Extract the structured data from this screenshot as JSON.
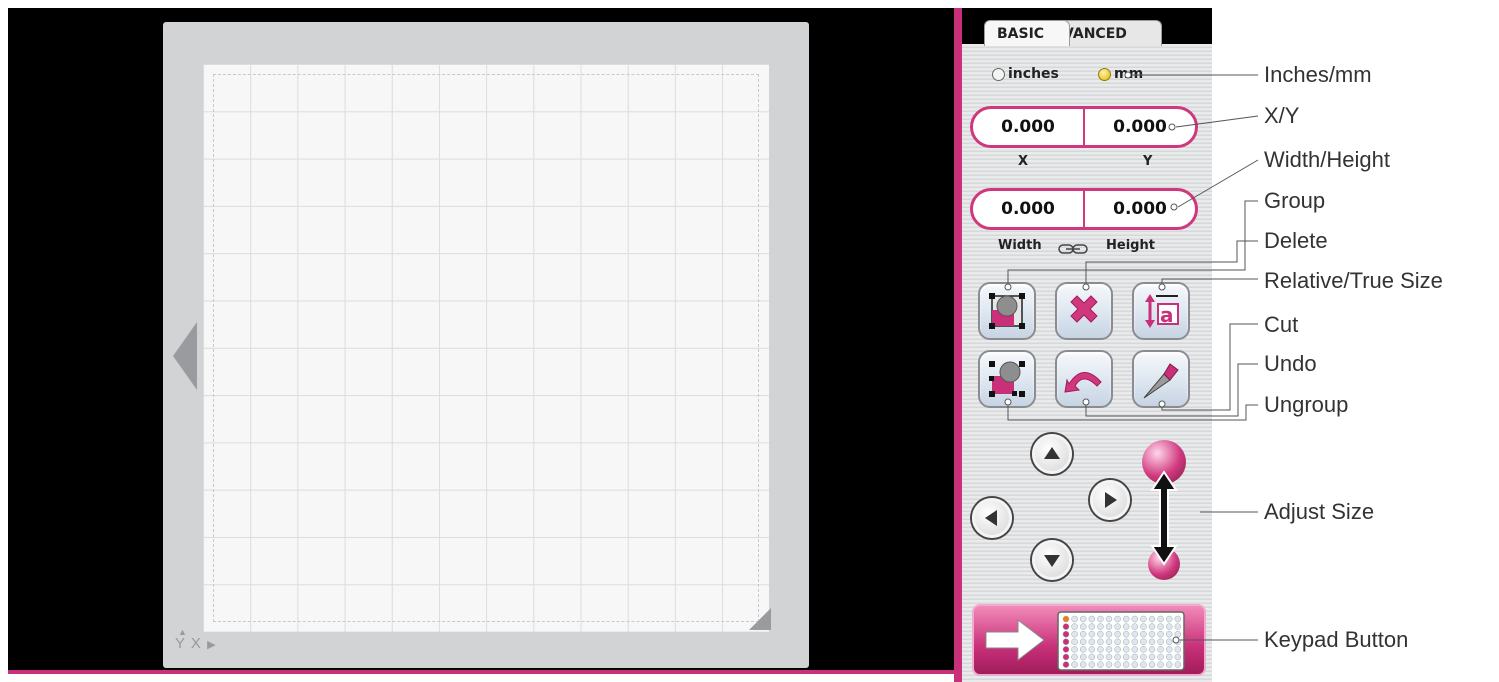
{
  "tabs": {
    "basic": "BASIC",
    "advanced": "VANCED"
  },
  "units": {
    "inches": "inches",
    "mm": "mm",
    "selected": "mm"
  },
  "position": {
    "x": "0.000",
    "y": "0.000",
    "x_label": "X",
    "y_label": "Y"
  },
  "size": {
    "width": "0.000",
    "height": "0.000",
    "width_label": "Width",
    "height_label": "Height"
  },
  "mat": {
    "axis_label": "Y X"
  },
  "colors": {
    "accent": "#c9307a",
    "canvas_bg": "#000000",
    "mat": "#d2d3d5",
    "grid": "#f7f7f7"
  },
  "icons": {
    "group": "group-icon",
    "delete": "delete-icon",
    "relative_size": "relative-true-size-icon",
    "ungroup": "ungroup-icon",
    "undo": "undo-icon",
    "cut": "blade-icon",
    "keypad": "keypad-icon"
  },
  "callouts": [
    {
      "id": "inches-mm",
      "label": "Inches/mm"
    },
    {
      "id": "xy",
      "label": "X/Y"
    },
    {
      "id": "width-height",
      "label": "Width/Height"
    },
    {
      "id": "group",
      "label": "Group"
    },
    {
      "id": "delete",
      "label": "Delete"
    },
    {
      "id": "relative-true-size",
      "label": "Relative/True Size"
    },
    {
      "id": "cut",
      "label": "Cut"
    },
    {
      "id": "undo",
      "label": "Undo"
    },
    {
      "id": "ungroup",
      "label": "Ungroup"
    },
    {
      "id": "adjust-size",
      "label": "Adjust Size"
    },
    {
      "id": "keypad-button",
      "label": "Keypad Button"
    }
  ]
}
